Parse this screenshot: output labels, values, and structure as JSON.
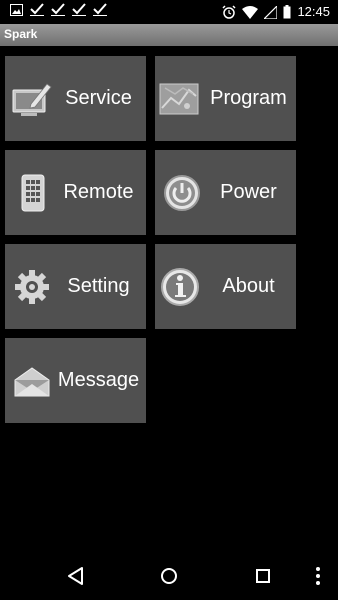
{
  "status_bar": {
    "time": "12:45",
    "left_icons": [
      "image-icon",
      "check-icon",
      "check-icon",
      "check-icon",
      "check-icon"
    ],
    "right_icons": [
      "alarm-icon",
      "wifi-icon",
      "signal-icon",
      "battery-icon"
    ]
  },
  "app": {
    "title": "Spark"
  },
  "tiles": [
    {
      "label": "Service",
      "icon": "monitor-edit-icon"
    },
    {
      "label": "Program",
      "icon": "map-icon"
    },
    {
      "label": "Remote",
      "icon": "remote-icon"
    },
    {
      "label": "Power",
      "icon": "power-icon"
    },
    {
      "label": "Setting",
      "icon": "gear-icon"
    },
    {
      "label": "About",
      "icon": "info-icon"
    },
    {
      "label": "Message",
      "icon": "envelope-icon"
    }
  ],
  "nav_bar": {
    "icons": [
      "back-icon",
      "home-icon",
      "recents-icon",
      "overflow-menu-icon"
    ]
  },
  "colors": {
    "tile": "#505050",
    "background": "#000000",
    "title_bar": "#8a8a8a"
  }
}
